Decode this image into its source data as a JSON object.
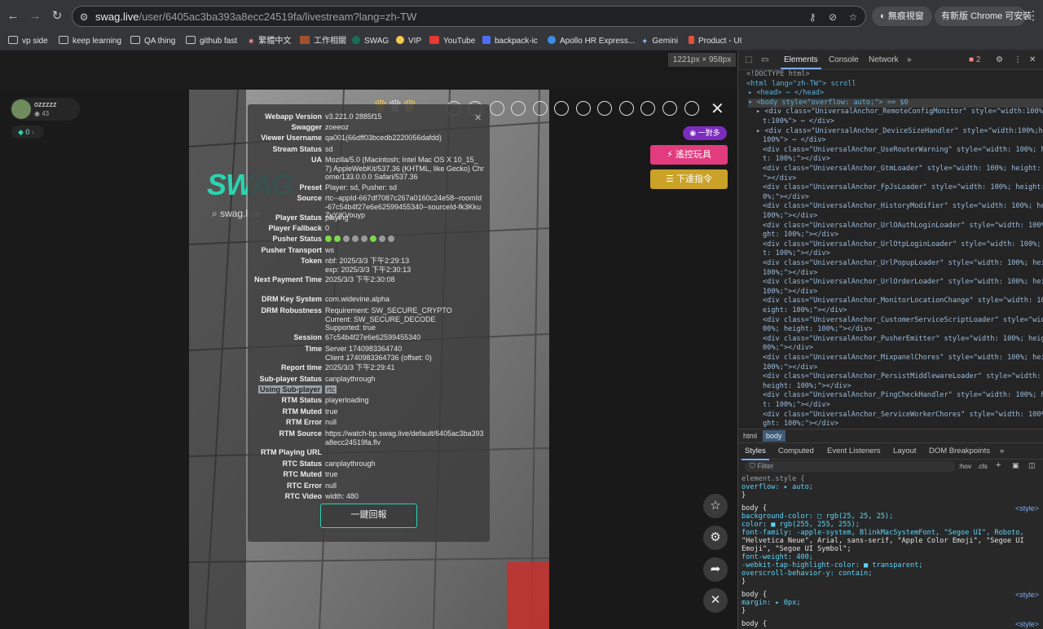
{
  "browser": {
    "url_host": "swag.live",
    "url_path": "/user/6405ac3ba393a8ecc24519fa/livestream?lang=zh-TW",
    "incognito_label": "無痕視窗",
    "update_label": "有新版 Chrome 可安裝"
  },
  "bookmarks": [
    {
      "label": "vp side",
      "icon": "folder-icon"
    },
    {
      "label": "keep learning",
      "icon": "folder-icon"
    },
    {
      "label": "QA thing",
      "icon": "folder-icon"
    },
    {
      "label": "github fast",
      "icon": "folder-icon"
    },
    {
      "label": "繁體中文",
      "icon": "star-burst-icon"
    },
    {
      "label": "工作相關",
      "icon": "briefcase-icon"
    },
    {
      "label": "SWAG",
      "icon": "swag-icon"
    },
    {
      "label": "VIP",
      "icon": "smiley-icon"
    },
    {
      "label": "YouTube",
      "icon": "youtube-icon"
    },
    {
      "label": "backpack-ic",
      "icon": "app-icon"
    },
    {
      "label": "Apollo HR Express...",
      "icon": "apollo-icon"
    },
    {
      "label": "Gemini",
      "icon": "gemini-icon"
    },
    {
      "label": "Product - UI",
      "icon": "figma-icon"
    }
  ],
  "viewport_badge": "1221px × 958px",
  "streamer": {
    "name": "ozzzzz",
    "viewers": "43",
    "diamonds": "0"
  },
  "video": {
    "logo_text": "SWAG",
    "search_placeholder": "swag.live"
  },
  "controls": {
    "one_to_many": "一對多",
    "remote_toy": "遙控玩具",
    "give_command": "下達指令",
    "back_button": "一鍵回報"
  },
  "debug": [
    {
      "k": "Webapp Version",
      "v": "v3.221.0 2885f15"
    },
    {
      "k": "Swagger",
      "v": "zoeeoz"
    },
    {
      "k": "Viewer Username",
      "v": "qa001(66dff03bcedb2220056dafdd)"
    },
    {
      "k": "Stream Status",
      "v": "sd"
    },
    {
      "k": "UA",
      "v": "Mozilla/5.0 (Macintosh; Intel Mac OS X 10_15_7) AppleWebKit/537.36 (KHTML, like Gecko) Chrome/133.0.0.0 Safari/537.36"
    },
    {
      "k": "Preset",
      "v": "Player: sd, Pusher: sd"
    },
    {
      "k": "Source",
      "v": "rtc--appId-667df7087c267a0160c24e58--roomId-67c54b4f27e6e62599455340--sourceId-fk3KkuZyYjKVouyp"
    },
    {
      "k": "Player Status",
      "v": "playing"
    },
    {
      "k": "Player Fallback",
      "v": "0"
    },
    {
      "k": "Pusher Status",
      "v": ""
    },
    {
      "k": "Pusher Transport",
      "v": "ws"
    },
    {
      "k": "Token",
      "v": "nbf: 2025/3/3 下午2:29:13\nexp: 2025/3/3 下午2:30:13"
    },
    {
      "k": "Next Payment Time",
      "v": "2025/3/3 下午2:30:08"
    },
    {
      "k": "DRM Key System",
      "v": "com.widevine.alpha"
    },
    {
      "k": "DRM Robustness",
      "v": "Requirement: SW_SECURE_CRYPTO\nCurrent: SW_SECURE_DECODE\nSupported: true"
    },
    {
      "k": "Session",
      "v": "67c54b4f27e6e62599455340"
    },
    {
      "k": "Time",
      "v": "Server 1740983364740\nClient 1740983364736 (offset: 0)"
    },
    {
      "k": "Report time",
      "v": "2025/3/3 下午2:29:41"
    },
    {
      "k": "Sub-player Status",
      "v": "canplaythrough"
    },
    {
      "k": "Using Sub-player",
      "v": "rtc"
    },
    {
      "k": "RTM Status",
      "v": "playerloading"
    },
    {
      "k": "RTM Muted",
      "v": "true"
    },
    {
      "k": "RTM Error",
      "v": "null"
    },
    {
      "k": "RTM Source",
      "v": "https://watch-bp.swag.live/default/6405ac3ba393a8ecc24519fa.flv"
    },
    {
      "k": "RTM Playing URL",
      "v": ""
    },
    {
      "k": "RTC Status",
      "v": "canplaythrough"
    },
    {
      "k": "RTC Muted",
      "v": "true"
    },
    {
      "k": "RTC Error",
      "v": "null"
    },
    {
      "k": "RTC Video",
      "v": "width: 480"
    }
  ],
  "pusher_dots": [
    "#7cd94a",
    "#7cd94a",
    "#9a9a9a",
    "#9a9a9a",
    "#9a9a9a",
    "#7cd94a",
    "#9a9a9a",
    "#9a9a9a"
  ],
  "devtools": {
    "tabs": [
      "Elements",
      "Console",
      "Network"
    ],
    "error_count": "2",
    "dom_lines": [
      "<!DOCTYPE html>",
      "<html lang=\"zh-TW\"> scroll",
      "▸ <head> ⋯ </head>",
      "▾ <body style=\"overflow: auto;\"> == $0",
      "▸ <div class=\"UniversalAnchor_RemoteConfigMonitor\" style=\"width:100%;heig",
      "t:100%\"> ⋯ </div>",
      "▸ <div class=\"UniversalAnchor_DeviceSizeHandler\" style=\"width:100%;height",
      "100%\"> ⋯ </div>",
      "<div class=\"UniversalAnchor_UseRouterWarning\" style=\"width: 100%; heigh",
      "t: 100%;\"></div>",
      "<div class=\"UniversalAnchor_GtmLoader\" style=\"width: 100%; height: 100%",
      "\"></div>",
      "<div class=\"UniversalAnchor_FpJsLoader\" style=\"width: 100%; height: 10",
      "0%;\"></div>",
      "<div class=\"UniversalAnchor_HistoryModifier\" style=\"width: 100%; heigh",
      "100%;\"></div>",
      "<div class=\"UniversalAnchor_UrlOAuthLoginLoader\" style=\"width: 100%; he",
      "ght: 100%;\"></div>",
      "<div class=\"UniversalAnchor_UrlOtpLoginLoader\" style=\"width: 100%; heig",
      "t: 100%;\"></div>",
      "<div class=\"UniversalAnchor_UrlPopupLoader\" style=\"width: 100%; height:",
      "100%;\"></div>",
      "<div class=\"UniversalAnchor_UrlOrderLoader\" style=\"width: 100%; height:",
      "100%;\"></div>",
      "<div class=\"UniversalAnchor_MonitorLocationChange\" style=\"width: 100%; h",
      "eight: 100%;\"></div>",
      "<div class=\"UniversalAnchor_CustomerServiceScriptLoader\" style=\"width:",
      "00%; height: 100%;\"></div>",
      "<div class=\"UniversalAnchor_PusherEmitter\" style=\"width: 100%; height:",
      "00%;\"></div>",
      "<div class=\"UniversalAnchor_MixpanelChores\" style=\"width: 100%; height:",
      "100%;\"></div>",
      "<div class=\"UniversalAnchor_PersistMiddlewareLoader\" style=\"width: 100%;",
      "height: 100%;\"></div>",
      "<div class=\"UniversalAnchor_PingCheckHandler\" style=\"width: 100%; heigh",
      "t: 100%;\"></div>",
      "<div class=\"UniversalAnchor_ServiceWorkerChores\" style=\"width: 100%; he",
      "ght: 100%;\"></div>"
    ],
    "crumbs": [
      "html",
      "body"
    ],
    "style_tabs": [
      "Styles",
      "Computed",
      "Event Listeners",
      "Layout",
      "DOM Breakpoints"
    ],
    "filter_placeholder": "Filter",
    "hov": ":hov",
    "cls": ".cls",
    "style_lines": [
      "element.style {",
      "  overflow: ▸ auto;",
      "}",
      "body {",
      "  background-color: □ rgb(25, 25, 25);",
      "  color: ■ rgb(255, 255, 255);",
      "  font-family: -apple-system, BlinkMacSystemFont, \"Segoe UI\", Roboto,",
      "      \"Helvetica Neue\", Arial, sans-serif, \"Apple Color Emoji\", \"Segoe UI",
      "      Emoji\", \"Segoe UI Symbol\";",
      "  font-weight: 400;",
      "  -webkit-tap-highlight-color: ■ transparent;",
      "  overscroll-behavior-y: contain;",
      "}",
      "body {",
      "  margin: ▸ 0px;",
      "}",
      "body {"
    ],
    "style_src": "<style>"
  }
}
